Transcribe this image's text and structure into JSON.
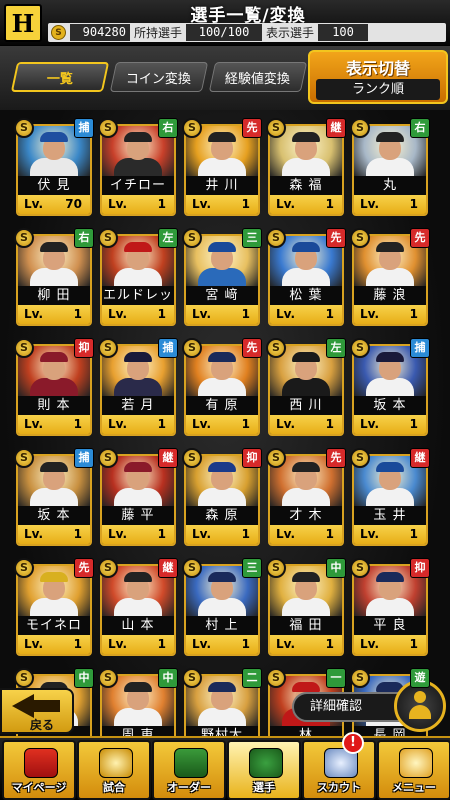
{
  "header": {
    "logo_text": "H",
    "title": "選手一覧/変換",
    "coin_icon": "S",
    "coins": "904280",
    "owned_label": "所持選手",
    "owned_value": "100/100",
    "shown_label": "表示選手",
    "shown_value": "100"
  },
  "tabs": {
    "list": "一覧",
    "coin_convert": "コイン変換",
    "exp_convert": "経験値変換",
    "sort_title": "表示切替",
    "sort_value": "ランク順"
  },
  "colors": {
    "捕": "#2b8bd6",
    "右": "#2f9a3a",
    "先": "#d62a2a",
    "継": "#d62a2a",
    "左": "#2f9a3a",
    "三": "#2f9a3a",
    "抑": "#d62a2a",
    "中": "#2f9a3a",
    "二": "#2f9a3a",
    "一": "#2f9a3a",
    "遊": "#2f9a3a"
  },
  "cards": [
    {
      "name": "伏 見",
      "lv_label": "Lv.",
      "lv": "70",
      "pos": "捕",
      "badge": "S",
      "jersey": "#e9e9e9",
      "cap": "#1f4fa0",
      "bg": "#3b88c8"
    },
    {
      "name": "イチロー",
      "lv_label": "Lv.",
      "lv": "1",
      "pos": "右",
      "badge": "S",
      "jersey": "#2a2a2a",
      "cap": "#222",
      "bg": "#c8402a"
    },
    {
      "name": "井 川",
      "lv_label": "Lv.",
      "lv": "1",
      "pos": "先",
      "badge": "S",
      "jersey": "#f2f2f2",
      "cap": "#222",
      "bg": "#e6a020"
    },
    {
      "name": "森 福",
      "lv_label": "Lv.",
      "lv": "1",
      "pos": "継",
      "badge": "S",
      "jersey": "#f2f2f2",
      "cap": "#222",
      "bg": "#d8c070"
    },
    {
      "name": "丸",
      "lv_label": "Lv.",
      "lv": "1",
      "pos": "右",
      "badge": "S",
      "jersey": "#f2f2f2",
      "cap": "#222",
      "bg": "#a8b8c8"
    },
    {
      "name": "柳 田",
      "lv_label": "Lv.",
      "lv": "1",
      "pos": "右",
      "badge": "S",
      "jersey": "#f2f2f2",
      "cap": "#222",
      "bg": "#d09050"
    },
    {
      "name": "エルドレッド",
      "lv_label": "Lv.",
      "lv": "1",
      "pos": "左",
      "badge": "S",
      "jersey": "#f2f2f2",
      "cap": "#c01818",
      "bg": "#c04020"
    },
    {
      "name": "宮 﨑",
      "lv_label": "Lv.",
      "lv": "1",
      "pos": "三",
      "badge": "S",
      "jersey": "#2a6aba",
      "cap": "#1a4a9a",
      "bg": "#e8c060"
    },
    {
      "name": "松 葉",
      "lv_label": "Lv.",
      "lv": "1",
      "pos": "先",
      "badge": "S",
      "jersey": "#f2f2f2",
      "cap": "#1a4a9a",
      "bg": "#3a7ad0"
    },
    {
      "name": "藤 浪",
      "lv_label": "Lv.",
      "lv": "1",
      "pos": "先",
      "badge": "S",
      "jersey": "#f2f2f2",
      "cap": "#222",
      "bg": "#e09030"
    },
    {
      "name": "則 本",
      "lv_label": "Lv.",
      "lv": "1",
      "pos": "抑",
      "badge": "S",
      "jersey": "#8a1a2a",
      "cap": "#8a1a2a",
      "bg": "#c04020"
    },
    {
      "name": "若 月",
      "lv_label": "Lv.",
      "lv": "1",
      "pos": "捕",
      "badge": "S",
      "jersey": "#2a2a4a",
      "cap": "#1a1a3a",
      "bg": "#e8a030"
    },
    {
      "name": "有 原",
      "lv_label": "Lv.",
      "lv": "1",
      "pos": "先",
      "badge": "S",
      "jersey": "#f2f2f2",
      "cap": "#1a2a5a",
      "bg": "#e08020"
    },
    {
      "name": "西 川",
      "lv_label": "Lv.",
      "lv": "1",
      "pos": "左",
      "badge": "S",
      "jersey": "#1a1a1a",
      "cap": "#1a1a1a",
      "bg": "#d8a040"
    },
    {
      "name": "坂 本",
      "lv_label": "Lv.",
      "lv": "1",
      "pos": "捕",
      "badge": "S",
      "jersey": "#f2f2f2",
      "cap": "#1a1a3a",
      "bg": "#3a5ab0"
    },
    {
      "name": "坂 本",
      "lv_label": "Lv.",
      "lv": "1",
      "pos": "捕",
      "badge": "S",
      "jersey": "#f2f2f2",
      "cap": "#222",
      "bg": "#c89040"
    },
    {
      "name": "藤 平",
      "lv_label": "Lv.",
      "lv": "1",
      "pos": "継",
      "badge": "S",
      "jersey": "#f2f2f2",
      "cap": "#8a1a2a",
      "bg": "#b83020"
    },
    {
      "name": "森 原",
      "lv_label": "Lv.",
      "lv": "1",
      "pos": "抑",
      "badge": "S",
      "jersey": "#f2f2f2",
      "cap": "#1a3a8a",
      "bg": "#d8a030"
    },
    {
      "name": "才 木",
      "lv_label": "Lv.",
      "lv": "1",
      "pos": "先",
      "badge": "S",
      "jersey": "#f2f2f2",
      "cap": "#222",
      "bg": "#d07030"
    },
    {
      "name": "玉 井",
      "lv_label": "Lv.",
      "lv": "1",
      "pos": "継",
      "badge": "S",
      "jersey": "#f2f2f2",
      "cap": "#1a4a9a",
      "bg": "#4a8ad0"
    },
    {
      "name": "モイネロ",
      "lv_label": "Lv.",
      "lv": "1",
      "pos": "先",
      "badge": "S",
      "jersey": "#f2f2f2",
      "cap": "#d8b020",
      "bg": "#e0a030"
    },
    {
      "name": "山 本",
      "lv_label": "Lv.",
      "lv": "1",
      "pos": "継",
      "badge": "S",
      "jersey": "#f2f2f2",
      "cap": "#222",
      "bg": "#d04a2a"
    },
    {
      "name": "村 上",
      "lv_label": "Lv.",
      "lv": "1",
      "pos": "三",
      "badge": "S",
      "jersey": "#f2f2f2",
      "cap": "#1a2a5a",
      "bg": "#3a6ac0"
    },
    {
      "name": "福 田",
      "lv_label": "Lv.",
      "lv": "1",
      "pos": "中",
      "badge": "S",
      "jersey": "#f2f2f2",
      "cap": "#222",
      "bg": "#e0b040"
    },
    {
      "name": "平 良",
      "lv_label": "Lv.",
      "lv": "1",
      "pos": "抑",
      "badge": "S",
      "jersey": "#f2f2f2",
      "cap": "#1a2a5a",
      "bg": "#c04030"
    },
    {
      "name": "",
      "lv_label": "",
      "lv": "",
      "pos": "中",
      "badge": "S",
      "jersey": "#f2f2f2",
      "cap": "#222",
      "bg": "#e0a030"
    },
    {
      "name": "周 東",
      "lv_label": "",
      "lv": "",
      "pos": "中",
      "badge": "S",
      "jersey": "#f2f2f2",
      "cap": "#222",
      "bg": "#e08030"
    },
    {
      "name": "野村大",
      "lv_label": "",
      "lv": "",
      "pos": "二",
      "badge": "S",
      "jersey": "#f2f2f2",
      "cap": "#1a2a5a",
      "bg": "#d8a040"
    },
    {
      "name": "林",
      "lv_label": "",
      "lv": "",
      "pos": "一",
      "badge": "S",
      "jersey": "#c01818",
      "cap": "#c01818",
      "bg": "#c04020"
    },
    {
      "name": "長 岡",
      "lv_label": "",
      "lv": "",
      "pos": "遊",
      "badge": "S",
      "jersey": "#f2f2f2",
      "cap": "#1a2a5a",
      "bg": "#3a6ac0"
    }
  ],
  "back_label": "戻る",
  "detail_label": "詳細確認",
  "nav": [
    {
      "label": "マイページ",
      "icon": "home-icon"
    },
    {
      "label": "試合",
      "icon": "trophy-icon"
    },
    {
      "label": "オーダー",
      "icon": "field-icon"
    },
    {
      "label": "選手",
      "icon": "player-icon"
    },
    {
      "label": "スカウト",
      "icon": "scout-icon"
    },
    {
      "label": "メニュー",
      "icon": "menu-icon"
    }
  ],
  "scout_notification": "!"
}
